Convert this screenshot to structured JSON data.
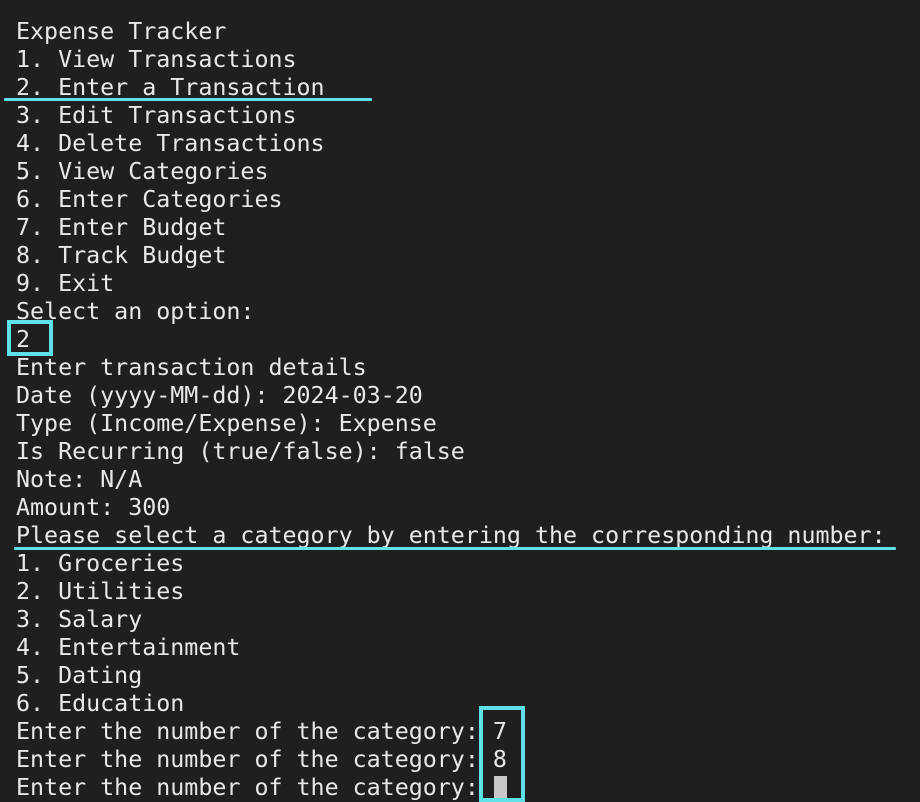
{
  "terminal": {
    "lines": [
      "Expense Tracker",
      "1. View Transactions",
      "2. Enter a Transaction",
      "3. Edit Transactions",
      "4. Delete Transactions",
      "5. View Categories",
      "6. Enter Categories",
      "7. Enter Budget",
      "8. Track Budget",
      "9. Exit",
      "Select an option:",
      "2",
      "Enter transaction details",
      "Date (yyyy-MM-dd): 2024-03-20",
      "Type (Income/Expense): Expense",
      "Is Recurring (true/false): false",
      "Note: N/A",
      "Amount: 300",
      "Please select a category by entering the corresponding number: ",
      "1. Groceries",
      "2. Utilities",
      "3. Salary",
      "4. Entertainment",
      "5. Dating",
      "6. Education",
      "Enter the number of the category: 7",
      "Enter the number of the category: 8",
      "Enter the number of the category: "
    ]
  },
  "colors": {
    "background": "#1f1f1f",
    "text": "#e8e8e8",
    "annotation": "#5fe1e8",
    "cursor": "#c8c8c8"
  }
}
